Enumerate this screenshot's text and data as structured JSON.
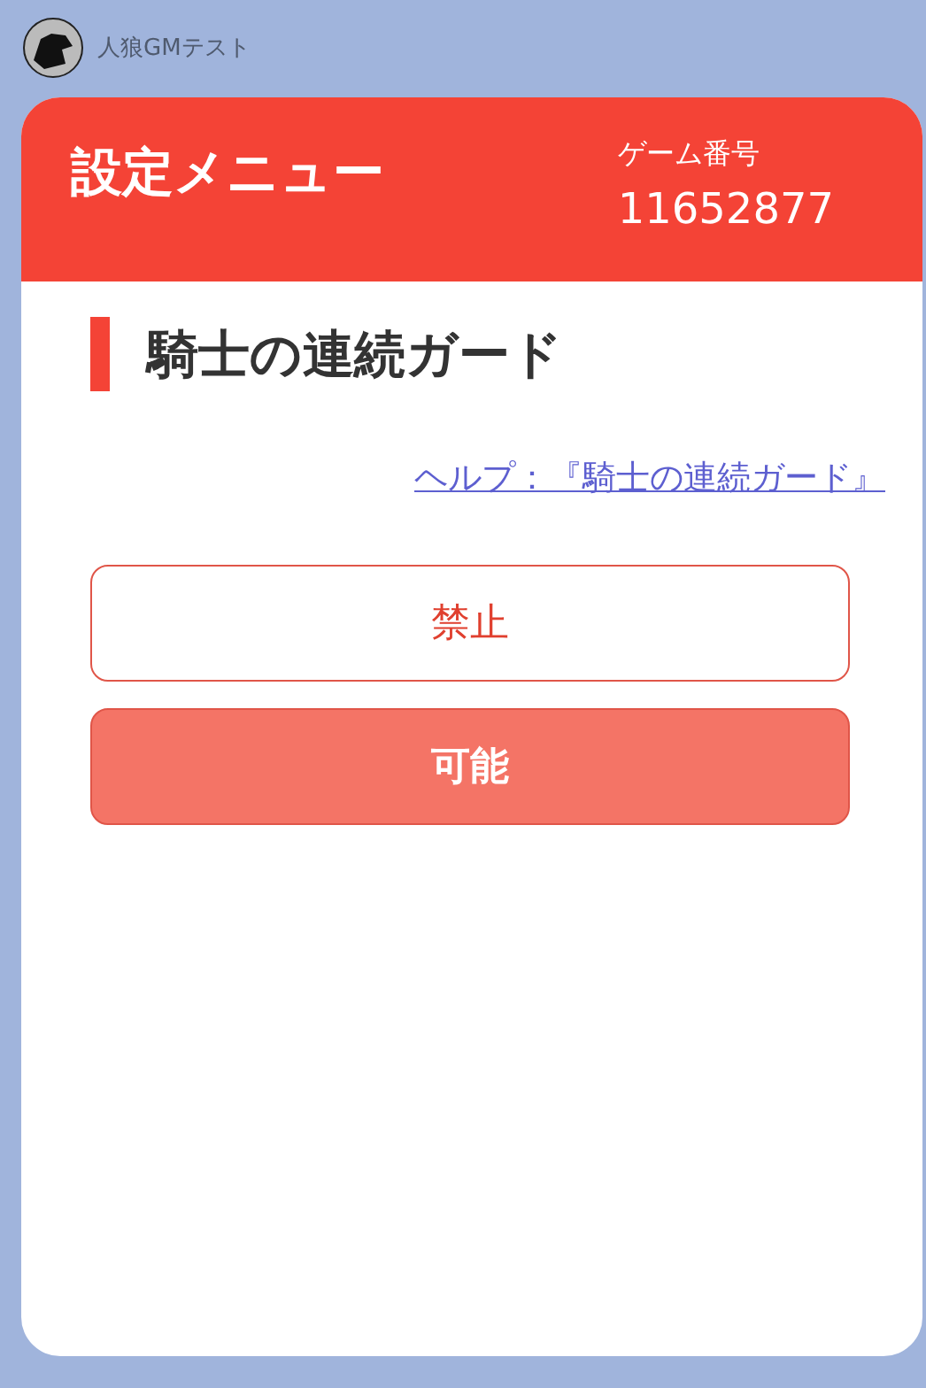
{
  "chat": {
    "sender": "人狼GMテスト"
  },
  "header": {
    "title": "設定メニュー",
    "game_label": "ゲーム番号",
    "game_number": "11652877"
  },
  "section": {
    "title": "騎士の連続ガード",
    "help_link": "ヘルプ：『騎士の連続ガード』"
  },
  "options": [
    {
      "label": "禁止",
      "selected": false
    },
    {
      "label": "可能",
      "selected": true
    }
  ]
}
